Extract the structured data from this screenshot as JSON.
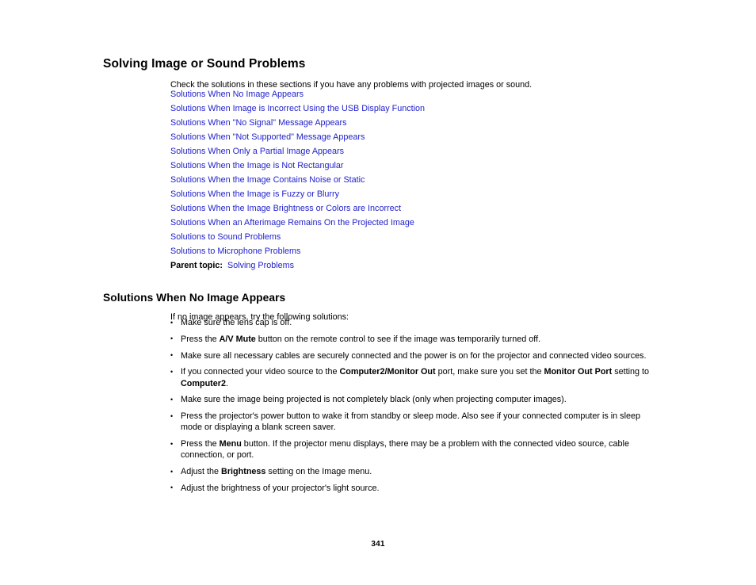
{
  "document": {
    "page_number": "341",
    "link_color": "#2222cc",
    "text_color": "#000000",
    "background_color": "#ffffff"
  },
  "section_one": {
    "heading": "Solving Image or Sound Problems",
    "intro": "Check the solutions in these sections if you have any problems with projected images or sound.",
    "links": [
      "Solutions When No Image Appears",
      "Solutions When Image is Incorrect Using the USB Display Function",
      "Solutions When \"No Signal\" Message Appears",
      "Solutions When \"Not Supported\" Message Appears",
      "Solutions When Only a Partial Image Appears",
      "Solutions When the Image is Not Rectangular",
      "Solutions When the Image Contains Noise or Static",
      "Solutions When the Image is Fuzzy or Blurry",
      "Solutions When the Image Brightness or Colors are Incorrect",
      "Solutions When an Afterimage Remains On the Projected Image",
      "Solutions to Sound Problems",
      "Solutions to Microphone Problems"
    ],
    "parent_topic": {
      "label": "Parent topic:",
      "link": "Solving Problems"
    }
  },
  "section_two": {
    "heading": "Solutions When No Image Appears",
    "intro": "If no image appears, try the following solutions:",
    "bullets": [
      [
        {
          "t": "Make sure the lens cap is off.",
          "b": false
        }
      ],
      [
        {
          "t": "Press the ",
          "b": false
        },
        {
          "t": "A/V Mute",
          "b": true
        },
        {
          "t": " button on the remote control to see if the image was temporarily turned off.",
          "b": false
        }
      ],
      [
        {
          "t": "Make sure all necessary cables are securely connected and the power is on for the projector and connected video sources.",
          "b": false
        }
      ],
      [
        {
          "t": "If you connected your video source to the ",
          "b": false
        },
        {
          "t": "Computer2/Monitor Out",
          "b": true
        },
        {
          "t": " port, make sure you set the ",
          "b": false
        },
        {
          "t": "Monitor Out Port",
          "b": true
        },
        {
          "t": " setting to ",
          "b": false
        },
        {
          "t": "Computer2",
          "b": true
        },
        {
          "t": ".",
          "b": false
        }
      ],
      [
        {
          "t": "Make sure the image being projected is not completely black (only when projecting computer images).",
          "b": false
        }
      ],
      [
        {
          "t": "Press the projector's power button to wake it from standby or sleep mode. Also see if your connected computer is in sleep mode or displaying a blank screen saver.",
          "b": false
        }
      ],
      [
        {
          "t": "Press the ",
          "b": false
        },
        {
          "t": "Menu",
          "b": true
        },
        {
          "t": " button. If the projector menu displays, there may be a problem with the connected video source, cable connection, or port.",
          "b": false
        }
      ],
      [
        {
          "t": "Adjust the ",
          "b": false
        },
        {
          "t": "Brightness",
          "b": true
        },
        {
          "t": " setting on the Image menu.",
          "b": false
        }
      ],
      [
        {
          "t": "Adjust the brightness of your projector's light source.",
          "b": false
        }
      ]
    ]
  }
}
